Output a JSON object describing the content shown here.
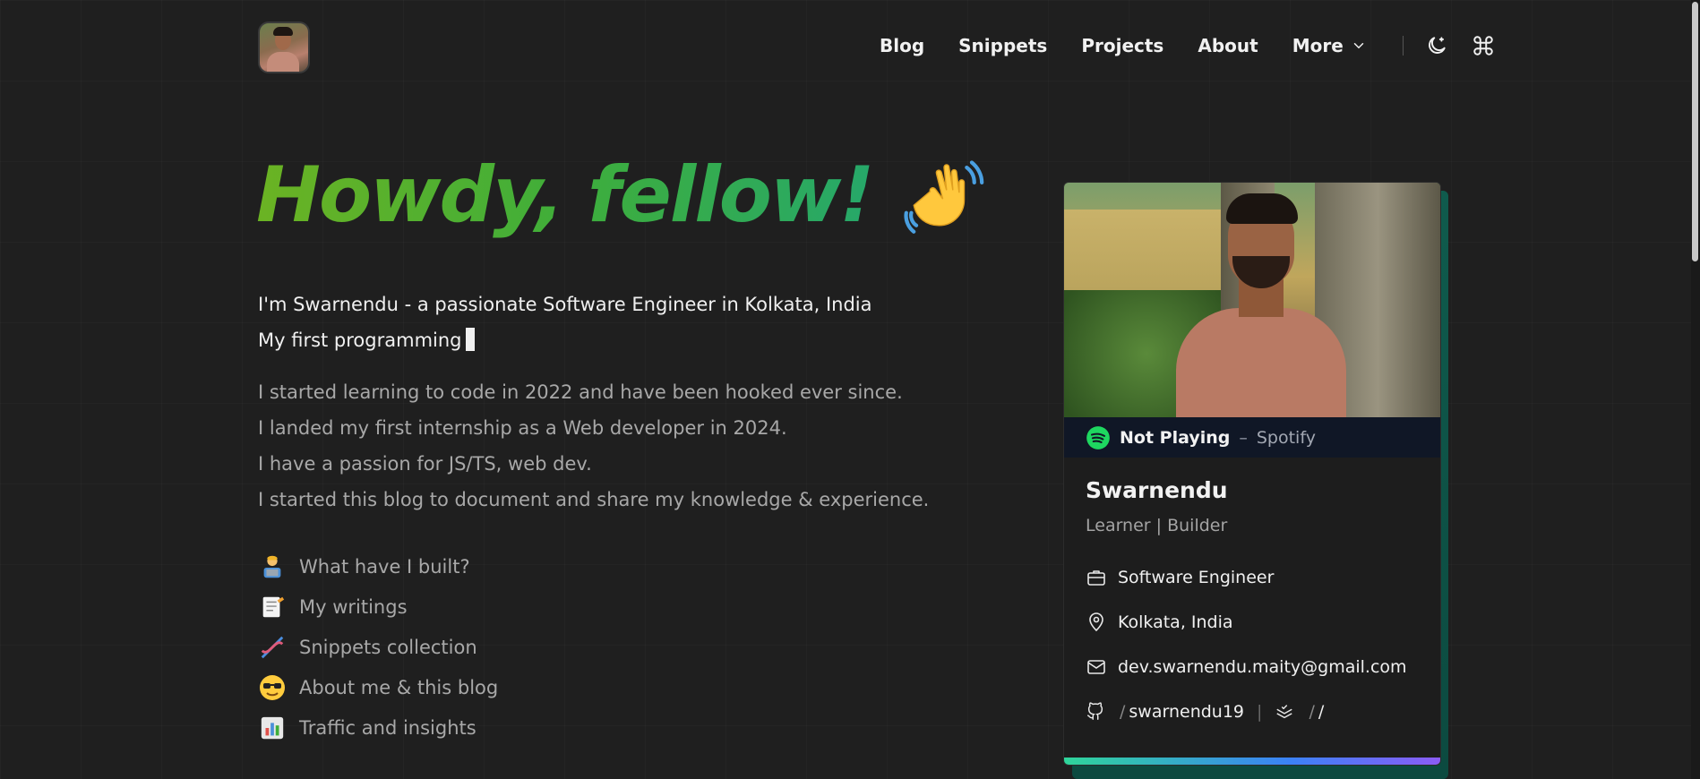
{
  "nav": {
    "links": [
      "Blog",
      "Snippets",
      "Projects",
      "About"
    ],
    "more_label": "More",
    "theme_icon": "moon-icon",
    "command_icon": "command-icon"
  },
  "hero": {
    "headline": "Howdy, fellow!",
    "emoji": "waving-hand"
  },
  "intro": {
    "line1": "I'm Swarnendu - a passionate Software Engineer in Kolkata, India",
    "line2": "My first programming"
  },
  "story": [
    "I started learning to code in 2022 and have been hooked ever since.",
    "I landed my first internship as a Web developer in 2024.",
    "I have a passion for JS/TS, web dev.",
    "I started this blog to document and share my knowledge & experience."
  ],
  "quick_links": [
    {
      "emoji": "technologist",
      "label": "What have I built?"
    },
    {
      "emoji": "memo",
      "label": "My writings"
    },
    {
      "emoji": "dna",
      "label": "Snippets collection"
    },
    {
      "emoji": "sunglasses-face",
      "label": "About me & this blog"
    },
    {
      "emoji": "bar-chart",
      "label": "Traffic and insights"
    }
  ],
  "profile": {
    "now_playing": "Not Playing",
    "now_playing_source": "Spotify",
    "name": "Swarnendu",
    "tagline": "Learner | Builder",
    "role": "Software Engineer",
    "location": "Kolkata, India",
    "email": "dev.swarnendu.maity@gmail.com",
    "github_handle": "swarnendu19",
    "second_handle": "/"
  },
  "colors": {
    "background": "#1f1f1f",
    "accent_green": "#3fae3a",
    "spotify_green": "#1ed760",
    "card_shadow": "#0f5b4d"
  }
}
